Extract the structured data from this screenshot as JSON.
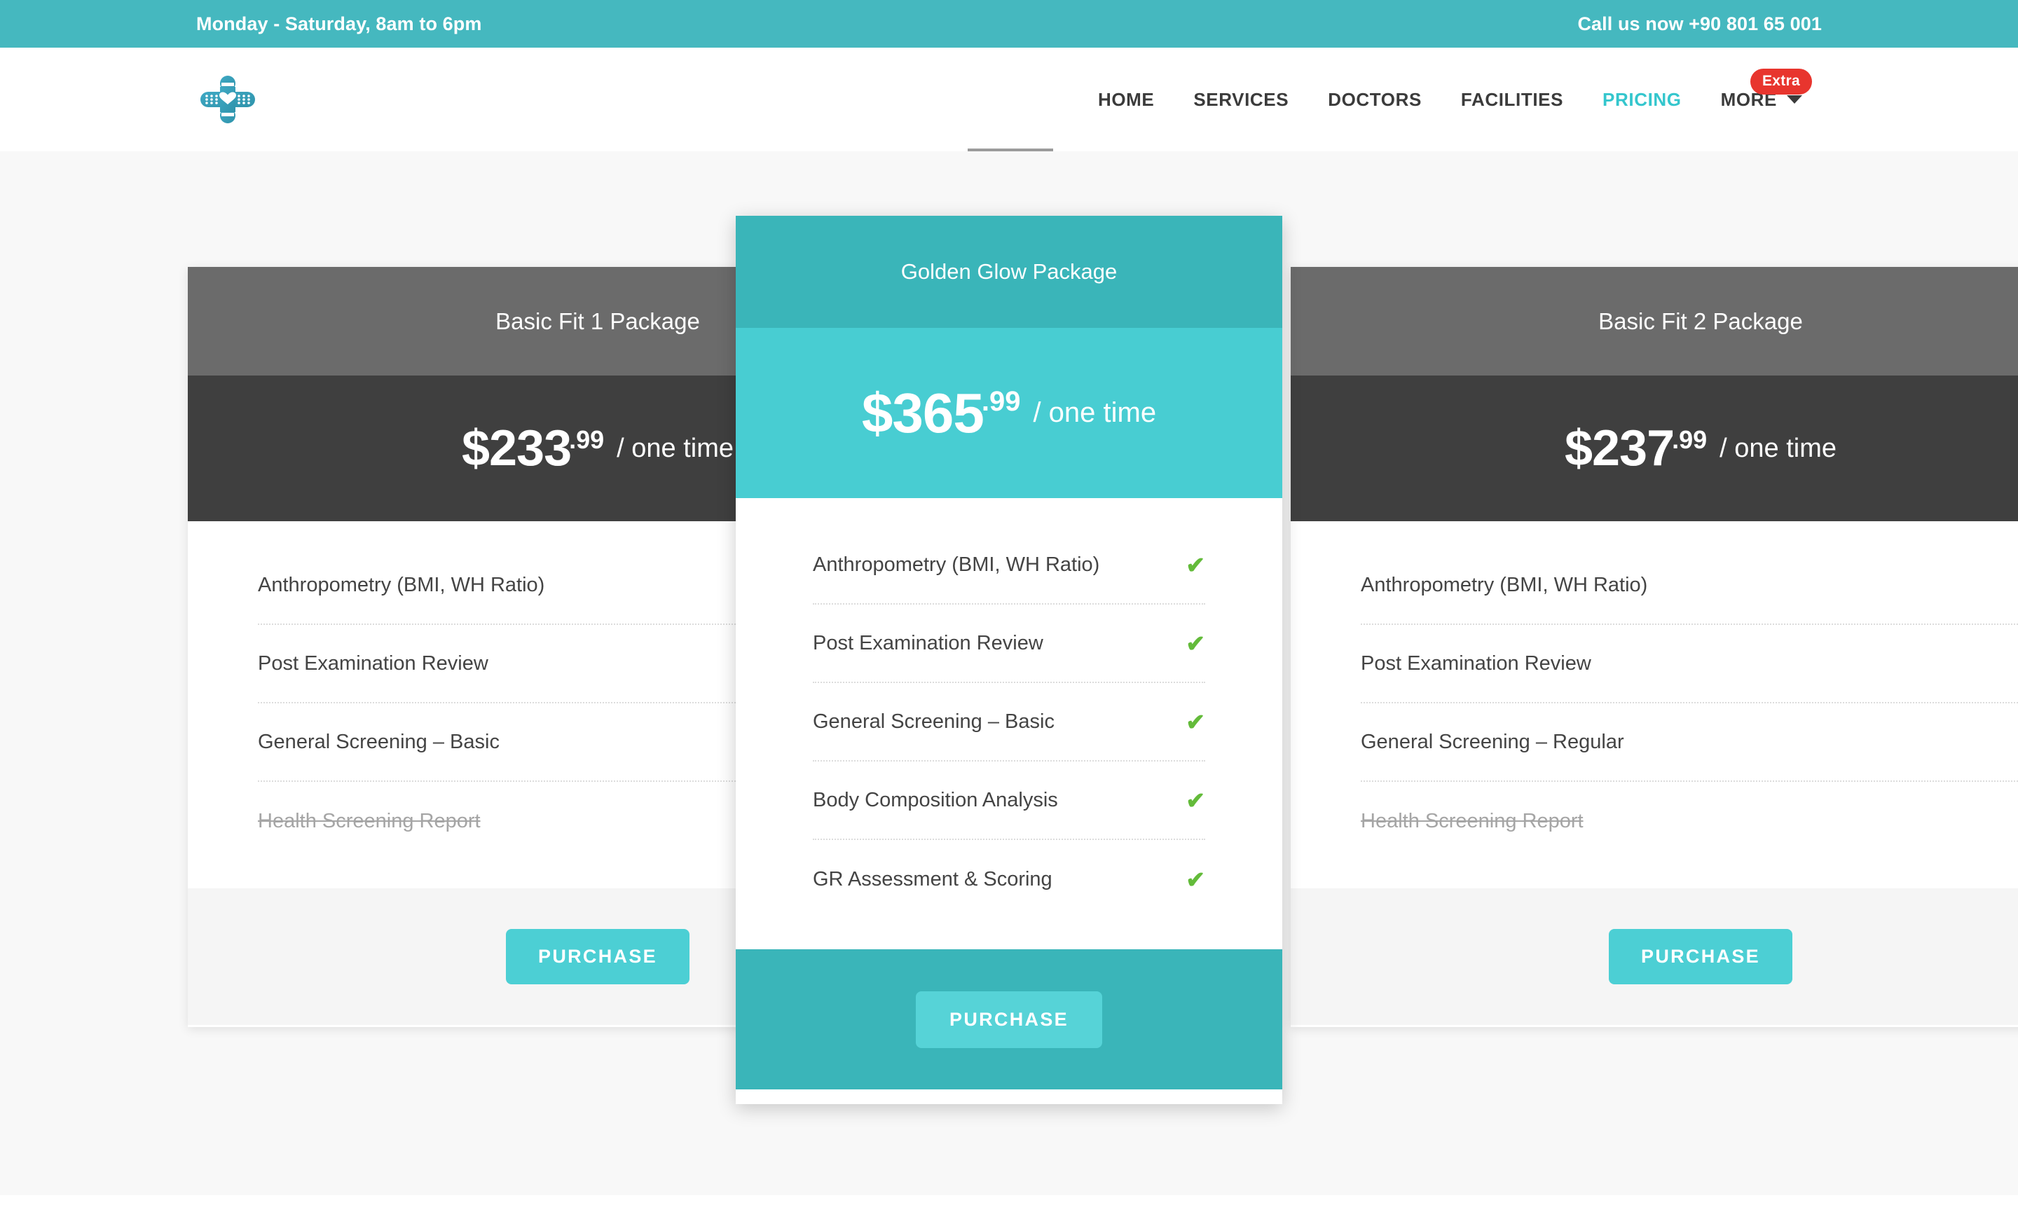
{
  "topbar": {
    "hours": "Monday - Saturday, 8am to 6pm",
    "phone": "Call us now +90 801 65 001",
    "bg_color": "#45b8bf"
  },
  "header": {
    "logo_icon": "bandage-heart-logo-icon",
    "nav": [
      {
        "label": "HOME",
        "active": false
      },
      {
        "label": "SERVICES",
        "active": false
      },
      {
        "label": "DOCTORS",
        "active": false
      },
      {
        "label": "FACILITIES",
        "active": false
      },
      {
        "label": "PRICING",
        "active": true
      },
      {
        "label": "MORE",
        "active": false,
        "has_caret": true
      }
    ],
    "badge": {
      "label": "Extra",
      "color": "#e8352e"
    },
    "active_color": "#34c6cd"
  },
  "pricing": {
    "purchase_label": "PURCHASE",
    "check_glyph": "✔",
    "cross_glyph": "✖",
    "check_color": "#63bb3a",
    "cross_color": "#e03b33",
    "cards": [
      {
        "id": "basic-fit-1",
        "title": "Basic Fit 1 Package",
        "price_main": "$233",
        "price_cents": ".99",
        "price_period": "/ one time",
        "featured": false,
        "head_color": "#6b6b6b",
        "price_color": "#3f3f3f",
        "features": [
          {
            "label": "Anthropometry (BMI, WH Ratio)",
            "included": true
          },
          {
            "label": "Post Examination Review",
            "included": true
          },
          {
            "label": "General Screening – Basic",
            "included": true
          },
          {
            "label": "Health Screening Report",
            "included": false
          }
        ]
      },
      {
        "id": "golden-glow",
        "title": "Golden Glow Package",
        "price_main": "$365",
        "price_cents": ".99",
        "price_period": "/ one time",
        "featured": true,
        "head_color": "#3ab5b9",
        "price_color": "#48cdd2",
        "features": [
          {
            "label": "Anthropometry (BMI, WH Ratio)",
            "included": true
          },
          {
            "label": "Post Examination Review",
            "included": true
          },
          {
            "label": "General Screening – Basic",
            "included": true
          },
          {
            "label": "Body Composition Analysis",
            "included": true
          },
          {
            "label": "GR Assessment & Scoring",
            "included": true
          }
        ]
      },
      {
        "id": "basic-fit-2",
        "title": "Basic Fit 2 Package",
        "price_main": "$237",
        "price_cents": ".99",
        "price_period": "/ one time",
        "featured": false,
        "head_color": "#6b6b6b",
        "price_color": "#3f3f3f",
        "features": [
          {
            "label": "Anthropometry (BMI, WH Ratio)",
            "included": true
          },
          {
            "label": "Post Examination Review",
            "included": true
          },
          {
            "label": "General Screening – Regular",
            "included": true
          },
          {
            "label": "Health Screening Report",
            "included": false
          }
        ]
      }
    ]
  }
}
